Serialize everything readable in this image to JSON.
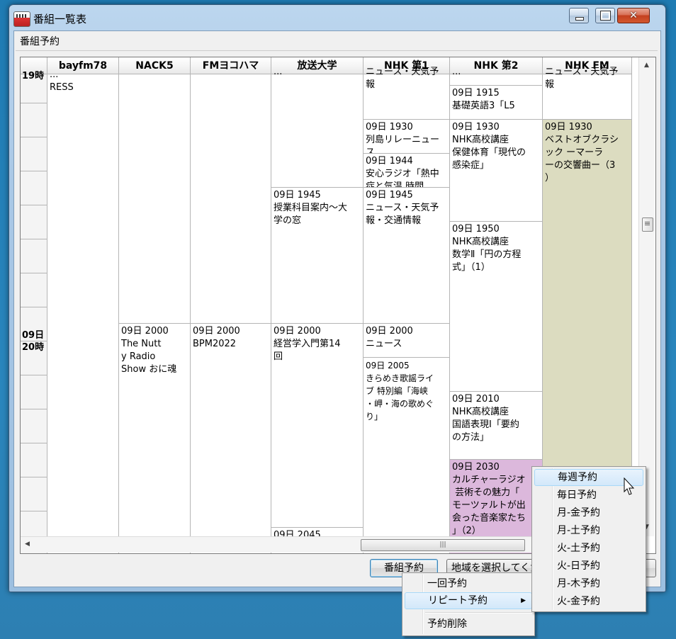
{
  "window": {
    "title": "番組一覧表",
    "section": "番組予約"
  },
  "headers": [
    "bayfm78",
    "NACK5",
    "FMヨコハマ",
    "放送大学",
    "NHK 第1",
    "NHK 第2",
    "NHK FM"
  ],
  "hours": [
    {
      "label": "19時"
    },
    {
      "label": "09日\n20時"
    }
  ],
  "columns": {
    "bayfm78": [
      {
        "text": "...\nRESS"
      }
    ],
    "nack5": [
      {
        "text": "09日 2000\nThe Nutt\ny Radio\nShow おに魂"
      }
    ],
    "fmyokohama": [
      {
        "text": "09日 2000\nBPM2022"
      }
    ],
    "housou": [
      {
        "text": "..."
      },
      {
        "text": "09日 1945\n授業科目案内～大\n学の窓"
      },
      {
        "text": "09日 2000\n経営学入門第14\n回"
      },
      {
        "text": "09日 2045"
      }
    ],
    "nhk1": [
      {
        "text": "ニュース・天気予\n報"
      },
      {
        "text": "09日 1930\n列島リレーニュー\nス"
      },
      {
        "text": "09日 1944\n安心ラジオ「熱中\n症と気温 時間"
      },
      {
        "text": "09日 1945\nニュース・天気予\n報・交通情報"
      },
      {
        "text": "09日 2000\nニュース"
      },
      {
        "text": "09日 2005\nきらめき歌謡ライ\nブ 特別編「海峡\n・岬・海の歌めぐ\nり」"
      }
    ],
    "nhk2": [
      {
        "text": "..."
      },
      {
        "text": "09日 1915\n基礎英語3「L5\n"
      },
      {
        "text": "09日 1930\nNHK高校講座\n保健体育「現代の\n感染症」"
      },
      {
        "text": "09日 1950\nNHK高校講座\n数学Ⅱ「円の方程\n式」（1）"
      },
      {
        "text": "09日 2010\nNHK高校講座\n国語表現Ⅰ「要約\nの方法」"
      },
      {
        "text": "09日 2030\nカルチャーラジオ\n 芸術その魅力「\nモーツァルトが出\n会った音楽家たち\n」（2）"
      }
    ],
    "nhkfm": [
      {
        "text": "ニュース・天気予\n報"
      },
      {
        "text": "09日 1930\nベストオブクラシ\nック ーマーラ\nーの交響曲ー（3\n）"
      }
    ]
  },
  "buttons": {
    "reserve": "番組予約",
    "region": "地域を選択してください"
  },
  "context_menu": {
    "items": [
      "一回予約",
      "リピート予約",
      "予約削除"
    ]
  },
  "repeat_menu": {
    "items": [
      "毎週予約",
      "毎日予約",
      "月-金予約",
      "月-土予約",
      "火-土予約",
      "火-日予約",
      "月-木予約",
      "火-金予約"
    ]
  },
  "colors": {
    "nhkfm_highlight": "#dcdcc0",
    "nhk2_highlight": "#dcb8dc"
  }
}
